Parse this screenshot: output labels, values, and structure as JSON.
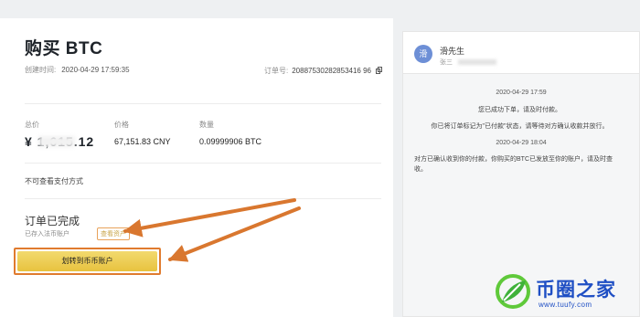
{
  "order": {
    "title": "购买 BTC",
    "created_label": "创建时间:",
    "created_value": "2020-04-29 17:59:35",
    "order_no_label": "订单号:",
    "order_no_value": "20887530282853416 96"
  },
  "stats": {
    "total_label": "总价",
    "total_value": "¥ 1,615.12",
    "price_label": "价格",
    "price_value": "67,151.83 CNY",
    "qty_label": "数量",
    "qty_value": "0.09999906 BTC"
  },
  "payment_note": "不可查看支付方式",
  "status": {
    "title": "订单已完成",
    "deposit_text": "已存入法币账户",
    "view_assets_label": "查看资产",
    "transfer_button_label": "划转到币币账户"
  },
  "chat": {
    "avatar_char": "滑",
    "name": "滑先生",
    "sub": "张三",
    "messages": [
      {
        "type": "time",
        "text": "2020-04-29 17:59"
      },
      {
        "type": "center",
        "text": "您已成功下单，请及时付款。"
      },
      {
        "type": "center",
        "text": "你已将订单标记为\"已付款\"状态，请等待对方确认收款并放行。"
      },
      {
        "type": "time",
        "text": "2020-04-29 18:04"
      },
      {
        "type": "left",
        "text": "对方已确认收到你的付款，你购买的BTC已发放至你的账户，请及时查收。"
      }
    ]
  },
  "brand": {
    "name": "币圈之家",
    "url": "www.tuufy.com",
    "color": "#1f4fc4"
  },
  "colors": {
    "accent": "#f0d25a",
    "annotation": "#e07b2e"
  }
}
